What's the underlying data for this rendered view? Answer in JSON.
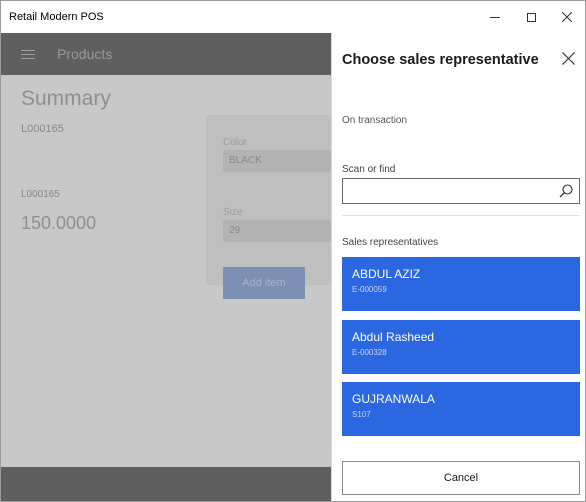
{
  "window": {
    "title": "Retail Modern POS",
    "controls": {
      "minimize": "minimize-icon",
      "maximize": "maximize-icon",
      "close": "close-icon"
    }
  },
  "appbar": {
    "title": "Products",
    "menu_icon": "hamburger-icon"
  },
  "background": {
    "summary_title": "Summary",
    "product_id_1": "L000165",
    "product_id_2": "L000165",
    "price": "150.0000",
    "color_label": "Color",
    "color_value": "BLACK",
    "size_label": "Size",
    "size_value": "29",
    "add_item_label": "Add item"
  },
  "panel": {
    "title": "Choose sales representative",
    "subtitle": "On transaction",
    "scan_label": "Scan or find",
    "search_value": "",
    "list_label": "Sales representatives",
    "representatives": [
      {
        "name": "ABDUL AZIZ",
        "id": "E-000059"
      },
      {
        "name": "Abdul Rasheed",
        "id": "E-000328"
      },
      {
        "name": "GUJRANWALA",
        "id": "S107"
      }
    ],
    "cancel_label": "Cancel",
    "accent_color": "#2b67e0"
  }
}
